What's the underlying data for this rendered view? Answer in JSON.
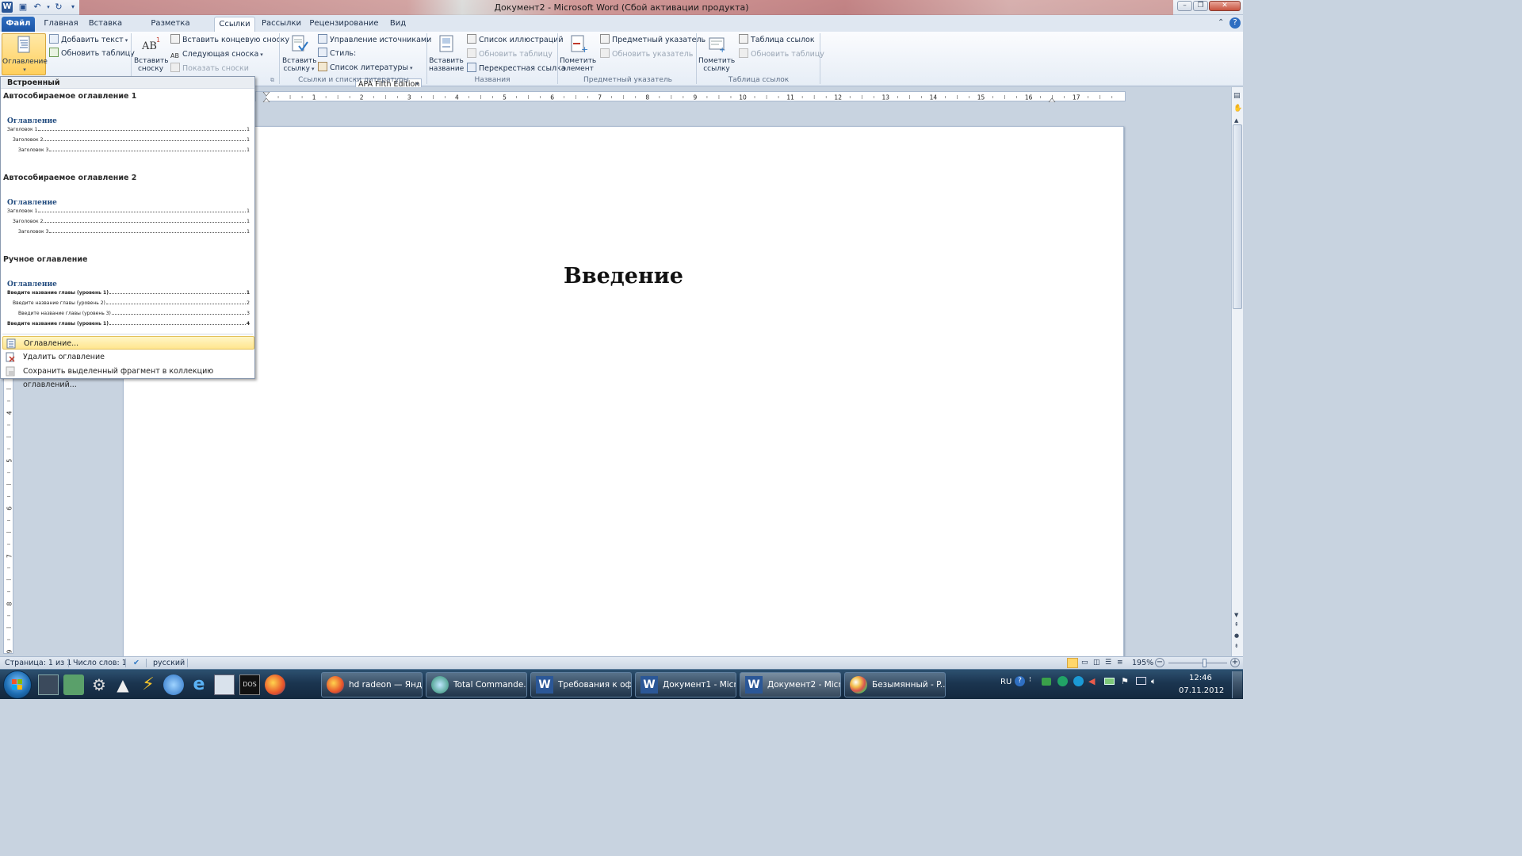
{
  "window": {
    "title": "Документ2  -  Microsoft Word (Сбой активации продукта)"
  },
  "tabs": [
    {
      "label": "Файл"
    },
    {
      "label": "Главная"
    },
    {
      "label": "Вставка"
    },
    {
      "label": "Разметка страницы"
    },
    {
      "label": "Ссылки"
    },
    {
      "label": "Рассылки"
    },
    {
      "label": "Рецензирование"
    },
    {
      "label": "Вид"
    }
  ],
  "ribbon": {
    "toc": {
      "button": "Оглавление",
      "add_text": "Добавить текст",
      "update_table": "Обновить таблицу"
    },
    "footnotes": {
      "insert_footnote_1": "Вставить",
      "insert_footnote_2": "сноску",
      "insert_endnote": "Вставить концевую сноску",
      "next_footnote": "Следующая сноска",
      "show_notes": "Показать сноски"
    },
    "citations": {
      "insert_citation_1": "Вставить",
      "insert_citation_2": "ссылку",
      "manage_sources": "Управление источниками",
      "style_label": "Стиль:",
      "style_value": "APA Fifth Edition",
      "bibliography": "Список литературы",
      "group_label": "Ссылки и списки литературы"
    },
    "captions": {
      "insert_caption_1": "Вставить",
      "insert_caption_2": "название",
      "table_of_figures": "Список иллюстраций",
      "update_table": "Обновить таблицу",
      "cross_reference": "Перекрестная ссылка",
      "group_label": "Названия"
    },
    "index": {
      "mark_entry_1": "Пометить",
      "mark_entry_2": "элемент",
      "insert_index": "Предметный указатель",
      "update_index": "Обновить указатель",
      "group_label": "Предметный указатель"
    },
    "toa": {
      "mark_citation_1": "Пометить",
      "mark_citation_2": "ссылку",
      "insert_toa": "Таблица ссылок",
      "update_table": "Обновить таблицу",
      "group_label": "Таблица ссылок"
    }
  },
  "dropdown": {
    "header": "Встроенный",
    "auto1": {
      "title": "Автособираемое оглавление 1",
      "toc_heading": "Оглавление",
      "lines": [
        {
          "text": "Заголовок 1",
          "page": "1"
        },
        {
          "text": "Заголовок 2",
          "page": "1"
        },
        {
          "text": "Заголовок 3",
          "page": "1"
        }
      ]
    },
    "auto2": {
      "title": "Автособираемое оглавление 2",
      "toc_heading": "Оглавление",
      "lines": [
        {
          "text": "Заголовок 1",
          "page": "1"
        },
        {
          "text": "Заголовок 2",
          "page": "1"
        },
        {
          "text": "Заголовок 3",
          "page": "1"
        }
      ]
    },
    "manual": {
      "title": "Ручное оглавление",
      "toc_heading": "Оглавление",
      "lines": [
        {
          "text": "Введите название главы (уровень 1)",
          "page": "1"
        },
        {
          "text": "Введите название главы (уровень 2)",
          "page": "2"
        },
        {
          "text": "Введите название главы (уровень 3)",
          "page": "3"
        },
        {
          "text": "Введите название главы (уровень 1)",
          "page": "4"
        }
      ]
    },
    "menu": {
      "insert_toc": "Оглавление...",
      "remove_toc": "Удалить оглавление",
      "save_selection": "Сохранить выделенный фрагмент в коллекцию оглавлений..."
    }
  },
  "ruler": {
    "h_marks": [
      "1",
      "2",
      "3",
      "4",
      "5",
      "6",
      "7",
      "8",
      "9",
      "10",
      "11",
      "12",
      "13",
      "14",
      "15",
      "16",
      "17"
    ],
    "v_marks": [
      "4",
      "5",
      "6",
      "7",
      "8",
      "9"
    ]
  },
  "document": {
    "heading": "Введение"
  },
  "statusbar": {
    "page": "Страница: 1 из 1",
    "words": "Число слов: 1",
    "language": "русский",
    "zoom": "195%"
  },
  "taskbar": {
    "apps": [
      {
        "label": "hd radeon — Янд..."
      },
      {
        "label": "Total Commande..."
      },
      {
        "label": "Требования к оф..."
      },
      {
        "label": "Документ1 - Micr..."
      },
      {
        "label": "Документ2 - Micr..."
      },
      {
        "label": "Безымянный - P..."
      }
    ],
    "lang": "RU",
    "time": "12:46",
    "date": "07.11.2012"
  }
}
